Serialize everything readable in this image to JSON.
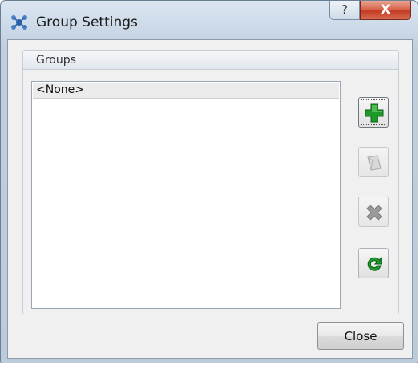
{
  "window": {
    "title": "Group Settings",
    "help_label": "?",
    "close_label": "X"
  },
  "groups": {
    "header": "Groups",
    "items": [
      {
        "label": "<None>"
      }
    ]
  },
  "toolbar": {
    "add": {
      "icon": "add-icon",
      "color": "#1e9a2a",
      "enabled": true
    },
    "edit": {
      "icon": "edit-icon",
      "enabled": false
    },
    "delete": {
      "icon": "delete-icon",
      "enabled": false
    },
    "refresh": {
      "icon": "refresh-icon",
      "color": "#1e9a2a",
      "enabled": true
    }
  },
  "footer": {
    "close_label": "Close"
  }
}
